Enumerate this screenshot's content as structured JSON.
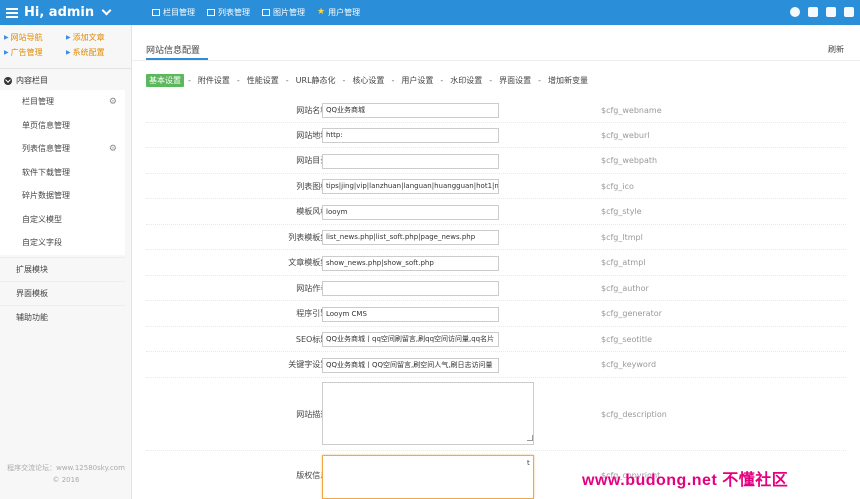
{
  "header": {
    "title": "Hi, admin",
    "nav": [
      {
        "label": "栏目管理",
        "icon": "grid-icon"
      },
      {
        "label": "列表管理",
        "icon": "list-icon"
      },
      {
        "label": "图片管理",
        "icon": "image-icon"
      },
      {
        "label": "用户管理",
        "icon": "star-icon"
      }
    ],
    "icons": [
      "home-icon",
      "window-icon",
      "message-icon",
      "user-icon"
    ],
    "colors": {
      "bar": "#2b8ed8",
      "active_tab": "#5cb85c",
      "link": "#e08a00"
    }
  },
  "sidebar": {
    "quick_links": [
      {
        "label": "网站导航"
      },
      {
        "label": "添加文章"
      },
      {
        "label": "广告管理"
      },
      {
        "label": "系统配置"
      }
    ],
    "section_title": "内容栏目",
    "sub_items": [
      {
        "label": "栏目管理",
        "gear": true
      },
      {
        "label": "单页信息管理",
        "gear": false
      },
      {
        "label": "列表信息管理",
        "gear": true
      },
      {
        "label": "软件下载管理",
        "gear": false
      },
      {
        "label": "碎片数据管理",
        "gear": false
      },
      {
        "label": "自定义模型",
        "gear": false
      },
      {
        "label": "自定义字段",
        "gear": false
      }
    ],
    "top_items": [
      {
        "label": "扩展模块"
      },
      {
        "label": "界面模板"
      },
      {
        "label": "辅助功能"
      }
    ],
    "footer_line1": "程序交流论坛：www.12580sky.com",
    "footer_line2": "© 2016"
  },
  "main": {
    "title": "网站信息配置",
    "refresh": "刷新",
    "tabs": [
      "基本设置",
      "附件设置",
      "性能设置",
      "URL静态化",
      "核心设置",
      "用户设置",
      "水印设置",
      "界面设置",
      "增加新变量"
    ],
    "fields": [
      {
        "label": "网站名称:",
        "value": "QQ业务商城",
        "var": "$cfg_webname"
      },
      {
        "label": "网站地址:",
        "value": "http:",
        "var": "$cfg_weburl"
      },
      {
        "label": "网站目录:",
        "value": "",
        "var": "$cfg_webpath"
      },
      {
        "label": "列表图标:",
        "value": "tips|jing|vip|lanzhuan|languan|huangguan|hot1|new1",
        "var": "$cfg_ico"
      },
      {
        "label": "模板风格:",
        "value": "looym",
        "var": "$cfg_style"
      },
      {
        "label": "列表模板集:",
        "value": "list_news.php|list_soft.php|page_news.php",
        "var": "$cfg_ltmpl"
      },
      {
        "label": "文章模板集:",
        "value": "show_news.php|show_soft.php",
        "var": "$cfg_atmpl"
      },
      {
        "label": "网站作者:",
        "value": "",
        "var": "$cfg_author"
      },
      {
        "label": "程序引擎:",
        "value": "Looym CMS",
        "var": "$cfg_generator"
      },
      {
        "label": "SEO标题:",
        "value": "QQ业务商城丨qq空间刷留言,刷qq空间访问量,qq名片",
        "var": "$cfg_seotitle"
      },
      {
        "label": "关键字设置:",
        "value": "QQ业务商城丨QQ空间留言,刷空间人气,刷日志访问量",
        "var": "$cfg_keyword"
      }
    ],
    "description": {
      "label": "网站描述:",
      "value": "",
      "var": "$cfg_description"
    },
    "copyright": {
      "label": "版权信息:",
      "value": "",
      "var": "$cfg_copyright"
    }
  },
  "watermark": "www.budong.net 不懂社区"
}
